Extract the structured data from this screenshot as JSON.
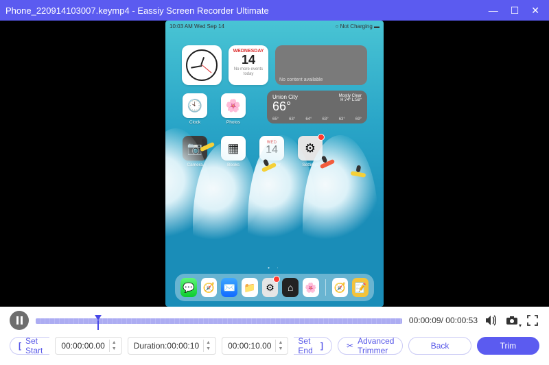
{
  "window": {
    "filename": "Phone_220914103007.keymp4",
    "separator": "  -  ",
    "appname": "Eassiy Screen Recorder Ultimate"
  },
  "ipad": {
    "status_time": "10:03 AM  Wed Sep 14",
    "status_right": "○ Not Charging ▬",
    "calendar": {
      "day": "WEDNESDAY",
      "num": "14",
      "sub": "No more events today"
    },
    "note": "No content available",
    "weather": {
      "city": "Union City",
      "temp": "66°",
      "cond": "Mostly Clear\nH:74° L:58°",
      "days": [
        "65°",
        "63°",
        "64°",
        "63°",
        "63°",
        "69°"
      ]
    },
    "apps_row1": [
      {
        "label": "Clock",
        "icon": "🕙"
      },
      {
        "label": "Photos",
        "icon": "🌸"
      }
    ],
    "apps_row2": [
      {
        "label": "Camera",
        "icon": "📷",
        "bg": "#3a3a3a"
      },
      {
        "label": "Books",
        "icon": "▦",
        "bg": "#fff"
      },
      {
        "label": "Calendar",
        "top": "WED",
        "num": "14"
      },
      {
        "label": "Settings",
        "icon": "⚙",
        "bg": "#e5e5e5",
        "badge": true
      }
    ]
  },
  "playback": {
    "current": "00:00:09",
    "total": "00:00:53",
    "sep": "/ ",
    "marker_pct": 17
  },
  "trimmer": {
    "set_start": "Set Start",
    "start_time": "00:00:00.00",
    "duration_label": "Duration:",
    "duration_value": "00:00:10",
    "end_time": "00:00:10.00",
    "set_end": "Set End",
    "advanced": "Advanced Trimmer",
    "back": "Back",
    "trim": "Trim",
    "bracket_l": "[",
    "bracket_r": "]",
    "scissors": "✂"
  }
}
